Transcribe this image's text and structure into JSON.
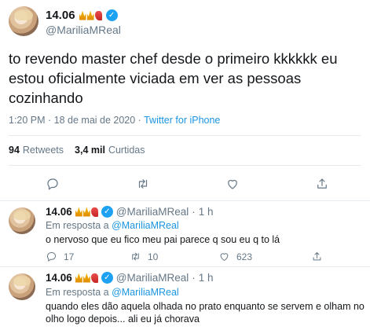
{
  "main_tweet": {
    "display_name": "14.06",
    "verified_mark": "✓",
    "handle": "@MariliaMReal",
    "text": "to revendo master chef desde o primeiro kkkkkk eu estou oficialmente viciada em ver as pessoas cozinhando",
    "timestamp": "1:20 PM · 18 de mai de 2020 · ",
    "source": "Twitter for iPhone",
    "retweets_count": "94",
    "retweets_label": "Retweets",
    "likes_count": "3,4 mil",
    "likes_label": "Curtidas",
    "actions": [
      "reply-icon",
      "retweet-icon",
      "like-icon",
      "share-icon"
    ]
  },
  "replies": [
    {
      "display_name": "14.06",
      "handle": "@MariliaMReal",
      "separator": "·",
      "time": "1 h",
      "in_reply_prefix": "Em resposta a ",
      "in_reply_handle": "@MariliaMReal",
      "text": "o nervoso que eu fico meu pai parece q sou eu q to lá",
      "reply_count": "17",
      "retweet_count": "10",
      "like_count": "623"
    },
    {
      "display_name": "14.06",
      "handle": "@MariliaMReal",
      "separator": "·",
      "time": "1 h",
      "in_reply_prefix": "Em resposta a ",
      "in_reply_handle": "@MariliaMReal",
      "text": "quando eles dão aquela olhada no prato enquanto se servem e olham no olho logo depois... ali eu já chorava"
    }
  ],
  "colors": {
    "link": "#1b95e0",
    "verified": "#1da1f2",
    "secondary_text": "#657786",
    "divider": "#e6ecf0"
  }
}
